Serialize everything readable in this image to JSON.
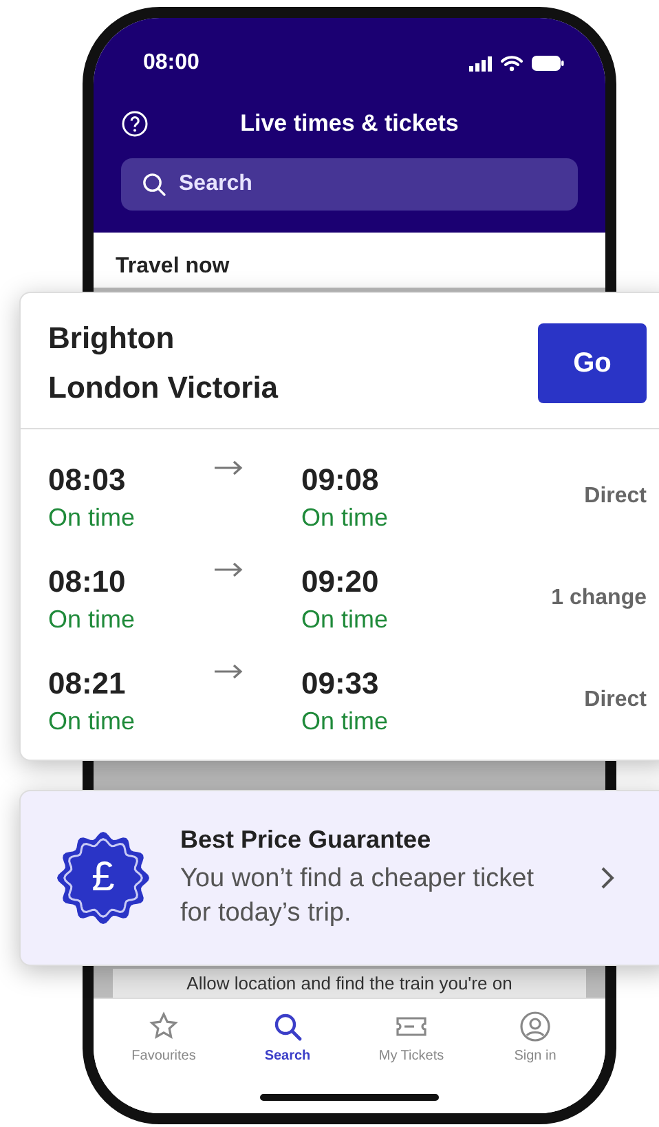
{
  "status_bar": {
    "time": "08:00"
  },
  "header": {
    "title": "Live times & tickets",
    "search": {
      "placeholder": "Search"
    }
  },
  "section": {
    "title": "Travel now",
    "hint": "Allow location and find the train you're on"
  },
  "journey": {
    "from": "Brighton",
    "to": "London Victoria",
    "go_button": "Go",
    "services": [
      {
        "depart": "08:03",
        "depart_status": "On time",
        "arrive": "09:08",
        "arrive_status": "On time",
        "changes": "Direct"
      },
      {
        "depart": "08:10",
        "depart_status": "On time",
        "arrive": "09:20",
        "arrive_status": "On time",
        "changes": "1 change"
      },
      {
        "depart": "08:21",
        "depart_status": "On time",
        "arrive": "09:33",
        "arrive_status": "On time",
        "changes": "Direct"
      }
    ]
  },
  "promo": {
    "title": "Best Price Guarantee",
    "text": "You won’t find a cheaper ticket for today’s trip.",
    "badge": "£"
  },
  "tab_bar": [
    {
      "kind": "star",
      "label": "Favourites",
      "selected": false
    },
    {
      "kind": "search",
      "label": "Search",
      "selected": true
    },
    {
      "kind": "ticket",
      "label": "My Tickets",
      "selected": false
    },
    {
      "kind": "person",
      "label": "Sign in",
      "selected": false
    }
  ]
}
